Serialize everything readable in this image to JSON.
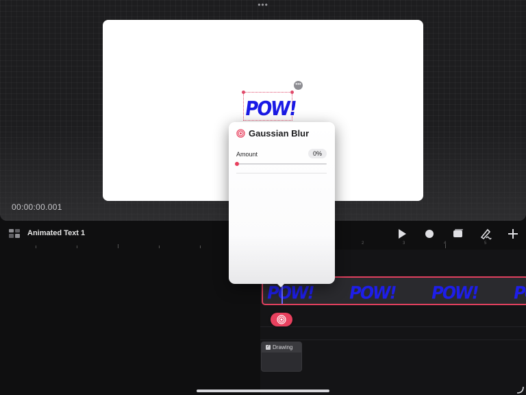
{
  "preview": {
    "more_dots": "•••",
    "timecode": "00:00:00.001",
    "canvas_text": "POW!"
  },
  "timeline": {
    "track_title": "Animated Text 1",
    "ruler_numbers": [
      "2",
      "3",
      "4",
      "5"
    ],
    "drawing_label": "Drawing"
  },
  "text_track": {
    "segments": [
      "POW!",
      "POW!",
      "POW!",
      "POW!"
    ]
  },
  "popover": {
    "title": "Gaussian Blur",
    "amount_label": "Amount",
    "amount_value": "0%",
    "amount_fraction": 0.0
  },
  "colors": {
    "accent": "#e8405e",
    "text_blue": "#1a1ae6"
  },
  "icons": {
    "layers": "layers-icon",
    "play": "play-icon",
    "record": "record-icon",
    "clip": "clip-icon",
    "pen": "pen-squiggle-icon",
    "add": "plus-icon",
    "effect": "effect-rings-icon"
  }
}
